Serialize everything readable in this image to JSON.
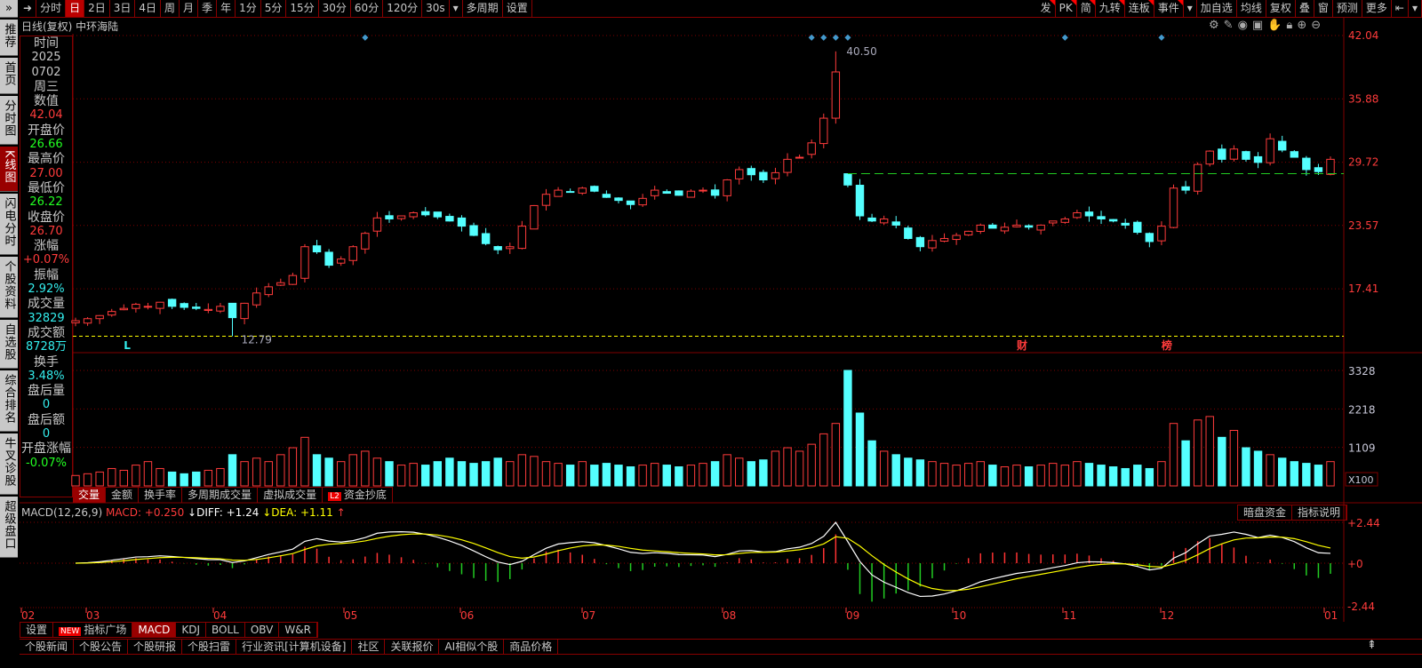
{
  "side_toggle": "»",
  "sidebar": [
    {
      "label": "推荐"
    },
    {
      "label": "首页"
    },
    {
      "label": "分时图"
    },
    {
      "label": "K线图",
      "active": true
    },
    {
      "label": "闪电分时"
    },
    {
      "label": "个股资料"
    },
    {
      "label": "自选股"
    },
    {
      "label": "综合排名"
    },
    {
      "label": "牛叉诊股"
    },
    {
      "label": "超级盘口"
    }
  ],
  "toolbar": {
    "left": [
      "分时",
      "日",
      "2日",
      "3日",
      "4日",
      "周",
      "月",
      "季",
      "年",
      "1分",
      "5分",
      "15分",
      "30分",
      "60分",
      "120分",
      "30s",
      "▾",
      "多周期",
      "设置"
    ],
    "active": "日",
    "right": [
      "发",
      "PK",
      "简",
      "九转",
      "连板",
      "事件",
      "▾",
      "加自选",
      "均线",
      "复权",
      "叠",
      "窗",
      "预测",
      "更多",
      "⇤",
      "▾"
    ],
    "flagged": [
      "发",
      "PK",
      "简",
      "九转",
      "连板",
      "事件"
    ]
  },
  "title": "日线(复权)  中环海陆",
  "chart_icons": [
    "gear-icon",
    "pen-icon",
    "eye-icon",
    "toolbox-icon",
    "hand-icon",
    "lock-icon",
    "zoom-in-icon",
    "zoom-out-icon"
  ],
  "info": [
    {
      "k": "时间",
      "v": "2025",
      "c": "#c8c8c8"
    },
    {
      "k": "",
      "v": "0702",
      "c": "#c8c8c8"
    },
    {
      "k": "",
      "v": "周三",
      "c": "#c8c8c8",
      "big": true
    },
    {
      "k": "数值",
      "v": "42.04",
      "c": "#ff3b3b"
    },
    {
      "k": "开盘价",
      "v": "26.66",
      "c": "#22ff22"
    },
    {
      "k": "最高价",
      "v": "27.00",
      "c": "#ff3b3b"
    },
    {
      "k": "最低价",
      "v": "26.22",
      "c": "#22ff22"
    },
    {
      "k": "收盘价",
      "v": "26.70",
      "c": "#ff3b3b"
    },
    {
      "k": "涨幅",
      "v": "+0.07%",
      "c": "#ff3b3b"
    },
    {
      "k": "振幅",
      "v": "2.92%",
      "c": "#33eeee"
    },
    {
      "k": "成交量",
      "v": "32829",
      "c": "#33eeee"
    },
    {
      "k": "成交额",
      "v": "8728万",
      "c": "#33eeee"
    },
    {
      "k": "换手",
      "v": "3.48%",
      "c": "#33eeee"
    },
    {
      "k": "盘后量",
      "v": "0",
      "c": "#33eeee"
    },
    {
      "k": "盘后额",
      "v": "0",
      "c": "#33eeee"
    },
    {
      "k": "开盘涨幅",
      "v": "-0.07%",
      "c": "#22ff22"
    }
  ],
  "colors": {
    "up": "#ff3b3b",
    "down": "#54ffff",
    "grid": "#800000",
    "diff": "#ffffff",
    "dea": "#ffff00"
  },
  "chart_data": {
    "type": "candlestick",
    "price_ticks": [
      "42.04",
      "35.88",
      "29.72",
      "23.57",
      "17.41"
    ],
    "price_range": [
      12.0,
      42.04
    ],
    "high_label": "40.50",
    "low_label": "12.79",
    "support_line": 28.6,
    "closes": [
      14.3,
      14.5,
      14.8,
      15.2,
      15.5,
      15.9,
      15.7,
      16.1,
      15.7,
      15.6,
      15.5,
      15.4,
      15.7,
      14.6,
      16.0,
      17.0,
      17.6,
      18.0,
      18.7,
      21.5,
      21.0,
      19.7,
      20.3,
      21.5,
      22.8,
      24.3,
      24.2,
      24.5,
      24.8,
      24.6,
      24.4,
      24.0,
      23.5,
      22.6,
      21.8,
      21.2,
      21.5,
      23.5,
      25.5,
      26.6,
      27.0,
      26.8,
      27.2,
      26.9,
      26.3,
      26.0,
      25.6,
      26.2,
      27.0,
      26.7,
      26.5,
      26.9,
      27.0,
      26.5,
      28.0,
      29.0,
      28.5,
      28.0,
      28.7,
      30.0,
      30.2,
      31.6,
      34.0,
      38.5,
      27.5,
      24.5,
      24.0,
      24.2,
      23.6,
      22.3,
      21.5,
      22.1,
      22.3,
      22.6,
      23.0,
      23.6,
      23.3,
      23.4,
      23.6,
      23.4,
      23.6,
      24.0,
      24.2,
      24.8,
      24.5,
      24.2,
      24.0,
      23.6,
      22.9,
      22.0,
      23.5,
      27.2,
      27.0,
      29.5,
      30.8,
      30.0,
      31.0,
      30.0,
      29.7,
      32.0,
      30.9,
      30.2,
      29.0,
      28.8,
      30.0
    ],
    "volumes": [
      300,
      350,
      400,
      500,
      450,
      600,
      700,
      500,
      400,
      350,
      400,
      450,
      500,
      900,
      700,
      800,
      700,
      900,
      1100,
      1400,
      900,
      800,
      700,
      900,
      1000,
      800,
      700,
      600,
      650,
      600,
      700,
      800,
      700,
      650,
      700,
      800,
      700,
      900,
      850,
      700,
      650,
      600,
      700,
      600,
      650,
      600,
      550,
      600,
      650,
      600,
      550,
      600,
      650,
      700,
      900,
      800,
      700,
      750,
      1000,
      1100,
      1000,
      1200,
      1500,
      1800,
      3328,
      2100,
      1300,
      1000,
      900,
      800,
      750,
      700,
      650,
      600,
      650,
      700,
      600,
      550,
      600,
      550,
      600,
      650,
      600,
      700,
      650,
      600,
      550,
      500,
      600,
      500,
      700,
      1800,
      1300,
      1900,
      2000,
      1400,
      1600,
      1100,
      1000,
      900,
      800,
      700,
      650,
      600,
      700
    ],
    "volume_ticks": [
      "3328",
      "2218",
      "1109"
    ],
    "volume_unit": "X100",
    "macd_ticks": [
      "+2.44",
      "+0",
      "-2.44"
    ],
    "months": [
      "02",
      "03",
      "04",
      "05",
      "06",
      "07",
      "08",
      "09",
      "10",
      "11",
      "12",
      "01"
    ],
    "event_markers": [
      {
        "label": "L",
        "color": "#33eeee"
      },
      {
        "label": "财",
        "color": "#ff3b3b"
      },
      {
        "label": "榜",
        "color": "#ff3b3b"
      }
    ]
  },
  "volume_tabs": [
    "交量",
    "金额",
    "换手率",
    "多周期成交量",
    "虚拟成交量",
    "资金抄底"
  ],
  "l2_badge": "L2",
  "macd_header": {
    "name": "MACD(12,26,9)",
    "macd": "MACD: +0.250",
    "diff": "↓DIFF: +1.24",
    "dea": "↓DEA: +1.11",
    "dea_arrow": "↑"
  },
  "macd_buttons": [
    "暗盘资金",
    "指标说明"
  ],
  "indicator_tabs": {
    "settings": "设置",
    "new_badge": "NEW",
    "square": "指标广场",
    "items": [
      "MACD",
      "KDJ",
      "BOLL",
      "OBV",
      "W&R"
    ],
    "active": "MACD"
  },
  "bottom_tabs": [
    "个股新闻",
    "个股公告",
    "个股研报",
    "个股扫雷",
    "行业资讯[计算机设备]",
    "社区",
    "关联报价",
    "AI相似个股",
    "商品价格"
  ],
  "scroll_top": "⇞"
}
